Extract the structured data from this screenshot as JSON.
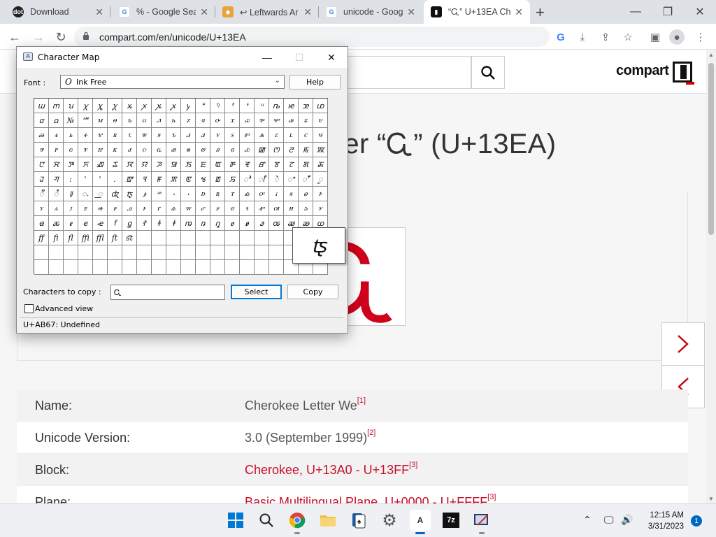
{
  "browser": {
    "tabs": [
      {
        "title": "Download",
        "favicon": "dot-icon",
        "active": false
      },
      {
        "title": "% - Google Sea",
        "favicon": "google-icon",
        "active": false
      },
      {
        "title": "↩ Leftwards Ar",
        "favicon": "bookmark-page-icon",
        "active": false
      },
      {
        "title": "unicode - Goog",
        "favicon": "google-icon",
        "active": false
      },
      {
        "title": "“Ꮹ” U+13EA Ch",
        "favicon": "compart-icon",
        "active": true
      }
    ],
    "url": "compart.com/en/unicode/U+13EA"
  },
  "page": {
    "brand": "compart",
    "title": "ter “Ꮹ” (U+13EA)",
    "glyph": "Ꮹ",
    "info": [
      {
        "key": "Name:",
        "value": "Cherokee Letter We",
        "ref": "[1]",
        "link": false
      },
      {
        "key": "Unicode Version:",
        "value": "3.0 (September 1999)",
        "ref": "[2]",
        "link": false
      },
      {
        "key": "Block:",
        "value": "Cherokee, U+13A0 - U+13FF",
        "ref": "[3]",
        "link": true
      },
      {
        "key": "Plane:",
        "value": "Basic Multilingual Plane, U+0000 - U+FFFF",
        "ref": "[3]",
        "link": true
      }
    ]
  },
  "charmap": {
    "title": "Character Map",
    "font_label": "Font :",
    "font_icon": "O",
    "font_value": "Ink Free",
    "help": "Help",
    "copy_label": "Characters to copy :",
    "copy_value": "Ꮹ",
    "select": "Select",
    "copy": "Copy",
    "advanced": "Advanced view",
    "status": "U+AB67: Undefined",
    "zoom_glyph": "ꭧ",
    "grid": [
      "ꭐ",
      "ꭑ",
      "ꭒ",
      "ꭓ",
      "ꭔ",
      "ꭕ",
      "ꭖ",
      "ꭗ",
      "ꭘ",
      "ꭙ",
      "ꭚ",
      "꭛",
      "ꭜ",
      "ꭝ",
      "ꭞ",
      "ꭟ",
      "ꭠ",
      "ꭡ",
      "ꭢ",
      "ꭣ",
      "ꭤ",
      "ꭥ",
      "№",
      "℠",
      "ꮇ",
      "ꮎ",
      "ꮏ",
      "ꮐ",
      "ꮑ",
      "ꮒ",
      "ꮓ",
      "ꮔ",
      "ꮕ",
      "ꮖ",
      "ꮗ",
      "ꮘ",
      "ꮙ",
      "ꮚ",
      "ꮛ",
      "ꮜ",
      "ꮝ",
      "ꮞ",
      "ꮟ",
      "ꮠ",
      "ꮡ",
      "ꮢ",
      "ꮣ",
      "ꮤ",
      "ꮥ",
      "ꮦ",
      "ꮧ",
      "ꮨ",
      "ꮩ",
      "ꮪ",
      "ꮫ",
      "ꮬ",
      "ꮭ",
      "ꮮ",
      "ꮯ",
      "ꮰ",
      "ꮱ",
      "ꮲ",
      "ꮳ",
      "ꮴ",
      "ꮵ",
      "ꮶ",
      "ꮷ",
      "ꮸ",
      "ꮹ",
      "ꮺ",
      "ꮻ",
      "ꮼ",
      "ꮽ",
      "ꮾ",
      "ꮿ",
      "ꯀ",
      "ꯁ",
      "ꯂ",
      "ꯃ",
      "ꯄ",
      "ꯅ",
      "ꯆ",
      "ꯇ",
      "ꯈ",
      "ꯉ",
      "ꯊ",
      "ꯋ",
      "ꯌ",
      "ꯍ",
      "ꯎ",
      "ꯏ",
      "ꯐ",
      "ꯑ",
      "ꯒ",
      "ꯓ",
      "ꯔ",
      "ꯕ",
      "ꯖ",
      "ꯗ",
      "ꯘ",
      "ꯙ",
      "ꯚ",
      ":",
      "'",
      "'",
      ".",
      "ꯛ",
      "ꯜ",
      "ꯝ",
      "ꯞ",
      "ꯟ",
      "ꯠ",
      "ꯡ",
      "ꯢ",
      "ꯣ",
      "ꯤ",
      "ꯥ",
      "ꯦ",
      "ꯧ",
      "ꯨ",
      "ꯩ",
      "ꯪ",
      "꯫",
      "꯬",
      "꯭",
      "ꭦ",
      "ꭧ",
      "ꭨ",
      "ꭩ",
      "꭪",
      "꭫",
      "ꭰ",
      "ꭱ",
      "ꭲ",
      "ꭳ",
      "ꭴ",
      "ꭵ",
      "ꭶ",
      "ꭷ",
      "ꭸ",
      "ꭹ",
      "ꭺ",
      "ꭻ",
      "ꭼ",
      "ꭽ",
      "ꭾ",
      "ꭿ",
      "ꮀ",
      "ꮁ",
      "ꮂ",
      "ꮃ",
      "ꮄ",
      "ꮅ",
      "ꮆ",
      "ꮈ",
      "ꮉ",
      "ꮊ",
      "ꮋ",
      "ꮌ",
      "ꮍ",
      "ꬰ",
      "ꬱ",
      "ꬲ",
      "ꬳ",
      "ꬴ",
      "ꬵ",
      "ꬶ",
      "ꬷ",
      "ꬸ",
      "ꬹ",
      "ꬺ",
      "ꬻ",
      "ꬼ",
      "ꬽ",
      "ꬾ",
      "ꬿ",
      "ꭀ",
      "ꭁ",
      "ꭂ",
      "ꭃ",
      "ﬀ",
      "ﬁ",
      "ﬂ",
      "ﬃ",
      "ﬄ",
      "ﬅ",
      "ﬆ",
      "",
      "",
      "",
      "",
      "",
      "",
      "",
      "",
      "",
      "",
      "",
      "",
      "",
      "",
      "",
      "",
      "",
      "",
      "",
      "",
      "",
      "",
      "",
      "",
      "",
      "",
      "",
      "",
      "",
      "",
      "",
      "",
      "",
      "",
      "",
      "",
      "",
      "",
      "",
      "",
      "",
      "",
      "",
      "",
      "",
      "",
      "",
      "",
      "",
      "",
      "",
      "",
      ""
    ]
  },
  "taskbar": {
    "time": "12:15 AM",
    "date": "3/31/2023",
    "notifications": "1"
  }
}
